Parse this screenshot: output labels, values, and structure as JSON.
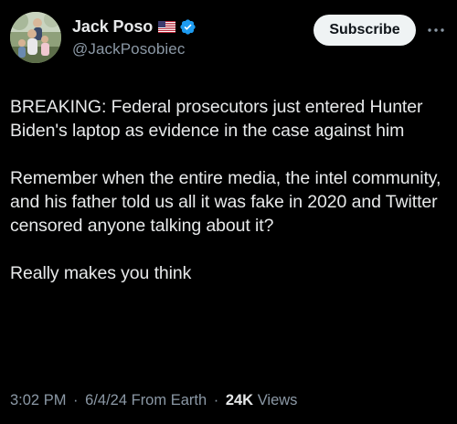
{
  "author": {
    "display_name": "Jack Poso",
    "handle": "@JackPosobiec",
    "flag_icon": "us-flag-icon",
    "verified_icon": "verified-badge-icon",
    "verified_color": "#1d9bf0"
  },
  "actions": {
    "subscribe_label": "Subscribe",
    "more_icon": "more-options-icon"
  },
  "tweet": {
    "paragraphs": [
      "BREAKING: Federal prosecutors just entered Hunter Biden's laptop as evidence in the case against him",
      "Remember when the entire media, the intel community, and his father told us all it was fake in 2020 and Twitter censored anyone talking about it?",
      "Really makes you think"
    ]
  },
  "meta": {
    "time": "3:02 PM",
    "separator": "·",
    "date": "6/4/24",
    "source": "From Earth",
    "views_count": "24K",
    "views_label": "Views"
  },
  "colors": {
    "background": "#000000",
    "text": "#e7e9ea",
    "secondary_text": "#8b98a5",
    "button_bg": "#eff3f4"
  }
}
